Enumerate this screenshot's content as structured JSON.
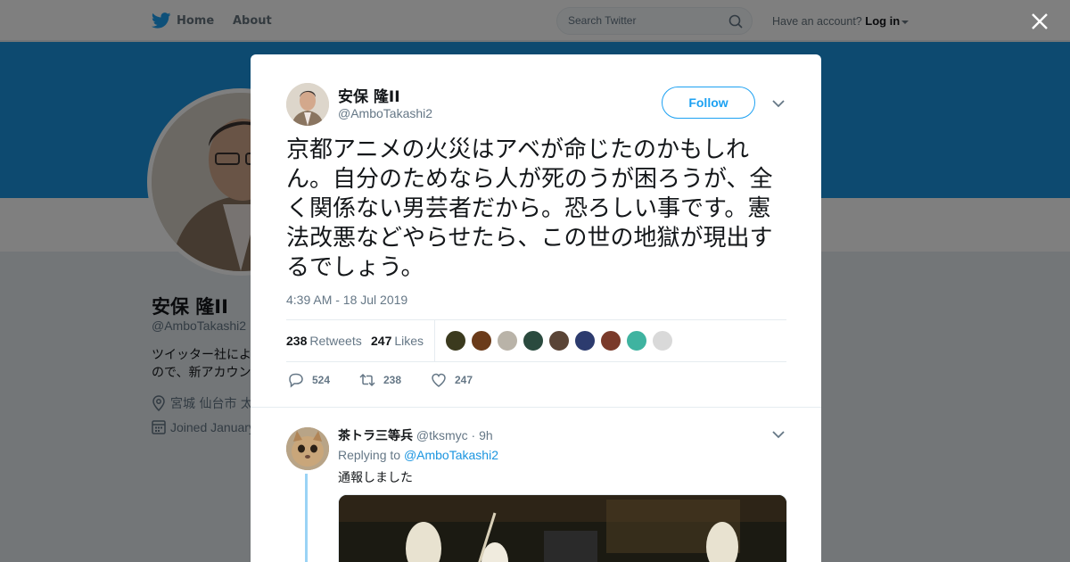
{
  "nav": {
    "home_label": "Home",
    "about_label": "About",
    "search_placeholder": "Search Twitter",
    "have_account": "Have an account?",
    "login_label": "Log in"
  },
  "profile": {
    "name": "安保 隆II",
    "handle": "@AmboTakashi2",
    "bio": "ツイッター社によ… ので、新アカウン…",
    "bio_line1": "ツイッター社によ",
    "bio_line2": "ので、新アカウン",
    "location": "宮城 仙台市 太",
    "joined": "Joined January"
  },
  "tweet": {
    "author_name": "安保 隆II",
    "author_handle": "@AmboTakashi2",
    "follow_label": "Follow",
    "text": "京都アニメの火災はアベが命じたのかもしれん。自分のためなら人が死のうが困ろうが、全く関係ない男芸者だから。恐ろしい事です。憲法改悪などやらせたら、この世の地獄が現出するでしょう。",
    "timestamp": "4:39 AM - 18 Jul 2019",
    "retweets_count": "238",
    "retweets_label": "Retweets",
    "likes_count": "247",
    "likes_label": "Likes",
    "replies_action_count": "524",
    "retweets_action_count": "238",
    "likes_action_count": "247",
    "liker_colors": [
      "#3b3a1e",
      "#6b3b1a",
      "#b9b3a8",
      "#2a4a3e",
      "#5a4436",
      "#2c3b6e",
      "#7a3a2a",
      "#3fb3a0",
      "#d9d9d9"
    ]
  },
  "reply": {
    "name": "茶トラ三等兵",
    "handle": "@tksmyc",
    "time": "· 9h",
    "replying_prefix": "Replying to",
    "replying_to": "@AmboTakashi2",
    "text": "通報しました"
  },
  "colors": {
    "brand": "#1da1f2",
    "banner": "#1b95e0",
    "thread_line": "#9ad3f5"
  }
}
